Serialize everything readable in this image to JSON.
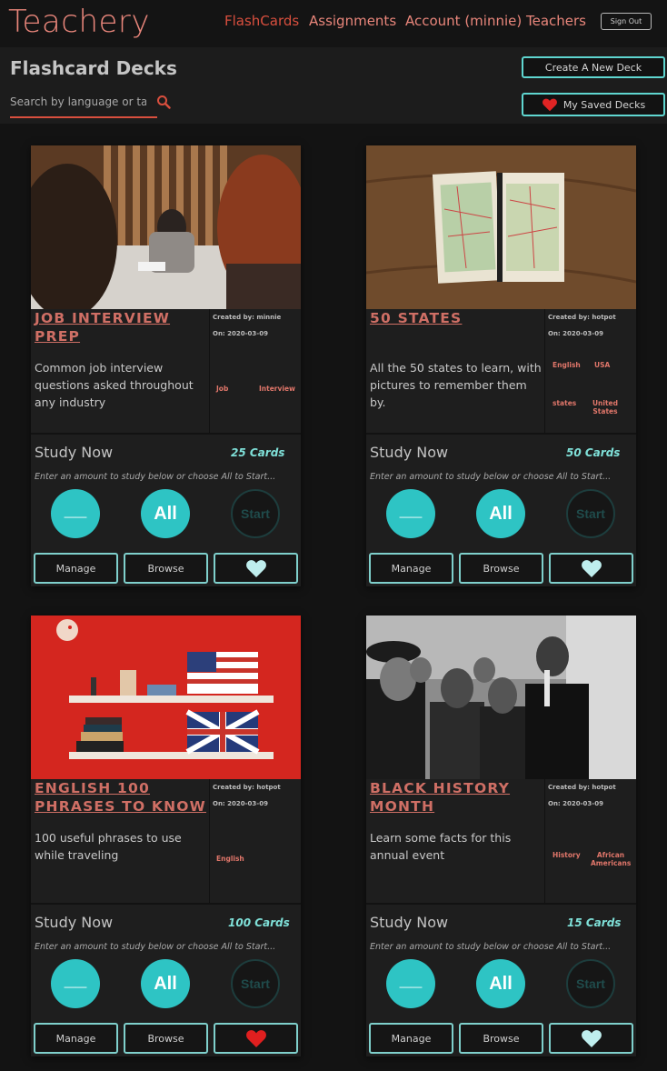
{
  "nav": {
    "brand": "Teachery",
    "links": [
      "FlashCards",
      "Assignments",
      "Account (minnie)",
      "Teachers"
    ],
    "signout_label": "Sign Out"
  },
  "header": {
    "title": "Flashcard Decks",
    "search_placeholder": "Search by language or tag",
    "create_label": "Create A New Deck",
    "saved_label": "My Saved Decks"
  },
  "colors": {
    "accent_teal": "#2ec4c4",
    "brand_coral": "#e9867b",
    "active_red": "#d94f3e",
    "background": "#131313"
  },
  "decks": [
    {
      "title": "JOB INTERVIEW PREP",
      "created_by": "Created by: minnie",
      "created_on": "On: 2020-03-09",
      "description": "Common job interview questions asked throughout any industry",
      "tags": [
        "Job",
        "Interview"
      ],
      "count": "25 Cards",
      "study_now": "Study Now",
      "hint": "Enter an amount to study below or choose All to Start...",
      "amount_label": "__",
      "all_label": "All",
      "start_label": "Start",
      "manage_label": "Manage",
      "browse_label": "Browse",
      "favorite_icon": "heart-icon-outline",
      "is_saved": false
    },
    {
      "title": "50 STATES",
      "created_by": "Created by: hotpot",
      "created_on": "On: 2020-03-09",
      "description": "All the 50 states to learn, with pictures to remember them by.",
      "tags": [
        "English",
        "USA",
        "states",
        "United States"
      ],
      "count": "50 Cards",
      "study_now": "Study Now",
      "hint": "Enter an amount to study below or choose All to Start...",
      "amount_label": "__",
      "all_label": "All",
      "start_label": "Start",
      "manage_label": "Manage",
      "browse_label": "Browse",
      "favorite_icon": "heart-icon-outline",
      "is_saved": false
    },
    {
      "title": "ENGLISH 100 PHRASES TO KNOW",
      "created_by": "Created by: hotpot",
      "created_on": "On: 2020-03-09",
      "description": "100 useful phrases to use while traveling",
      "tags": [
        "English"
      ],
      "count": "100 Cards",
      "study_now": "Study Now",
      "hint": "Enter an amount to study below or choose All to Start...",
      "amount_label": "__",
      "all_label": "All",
      "start_label": "Start",
      "manage_label": "Manage",
      "browse_label": "Browse",
      "favorite_icon": "heart-icon-filled",
      "is_saved": true
    },
    {
      "title": "BLACK HISTORY MONTH",
      "created_by": "Created by: hotpot",
      "created_on": "On: 2020-03-09",
      "description": "Learn some facts for this annual event",
      "tags": [
        "History",
        "African Americans"
      ],
      "count": "15 Cards",
      "study_now": "Study Now",
      "hint": "Enter an amount to study below or choose All to Start...",
      "amount_label": "__",
      "all_label": "All",
      "start_label": "Start",
      "manage_label": "Manage",
      "browse_label": "Browse",
      "favorite_icon": "heart-icon-outline",
      "is_saved": false
    }
  ]
}
